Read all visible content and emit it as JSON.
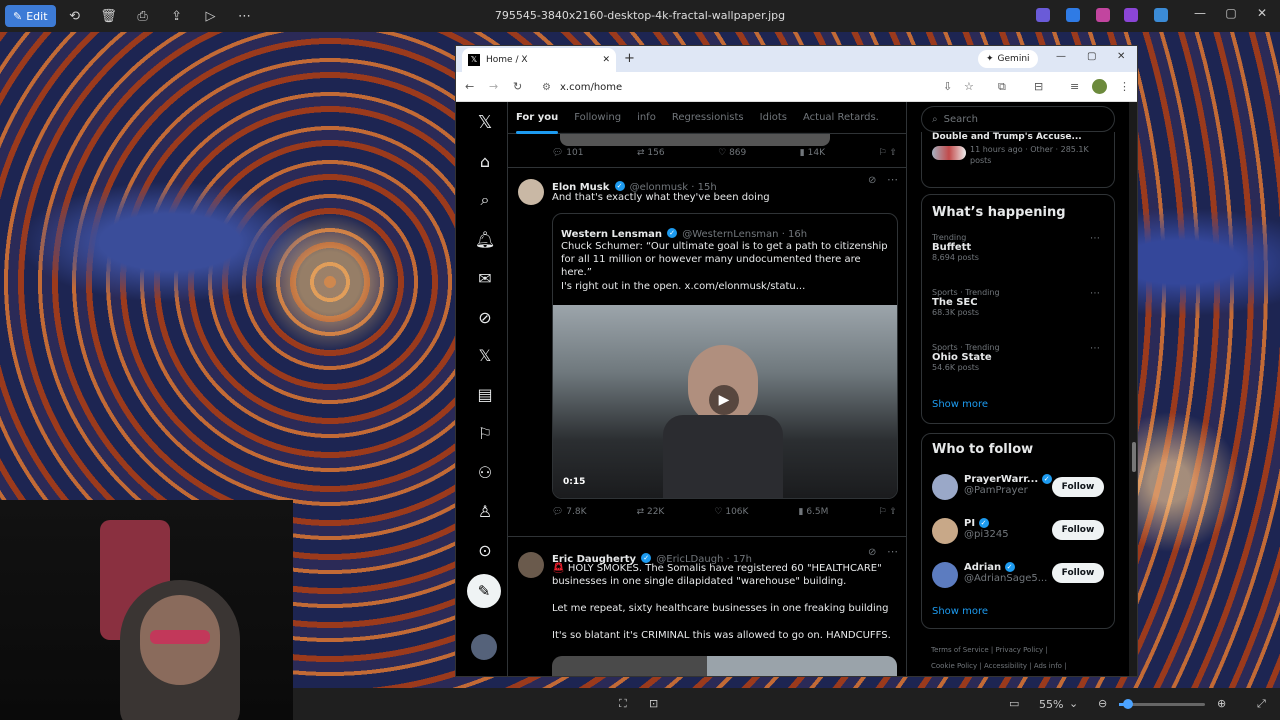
{
  "photos_app": {
    "edit_label": "Edit",
    "file_title": "795545-3840x2160-desktop-4k-fractal-wallpaper.jpg",
    "zoom": "55%"
  },
  "browser": {
    "tab_title": "Home / X",
    "url": "x.com/home",
    "gemini_label": "Gemini"
  },
  "x": {
    "tabs": [
      {
        "label": "For you"
      },
      {
        "label": "Following"
      },
      {
        "label": "info"
      },
      {
        "label": "Regressionists"
      },
      {
        "label": "Idiots"
      },
      {
        "label": "Actual Retards."
      }
    ],
    "prev_post_metrics": {
      "replies": "101",
      "reposts": "156",
      "likes": "869",
      "views": "14K"
    },
    "post1": {
      "name": "Elon Musk",
      "handle": "@elonmusk · 15h",
      "text": "And that's exactly what they've been doing",
      "quote": {
        "name": "Western Lensman",
        "handle": "@WesternLensman · 16h",
        "text1": "Chuck Schumer: “Our ultimate goal is to get a path to citizenship for all 11 million or however many undocumented there are here.”",
        "text2": "I's right out in the open.",
        "link": "x.com/elonmusk/statu...",
        "video_time": "0:15"
      },
      "metrics": {
        "replies": "7.8K",
        "reposts": "22K",
        "likes": "106K",
        "views": "6.5M"
      }
    },
    "post2": {
      "name": "Eric Daugherty",
      "handle": "@EricLDaugh · 17h",
      "text1": "HOLY SMOKES. The Somalis have registered 60 \"HEALTHCARE\" businesses in one single dilapidated \"warehouse\" building.",
      "text2": "Let me repeat, sixty healthcare businesses in one freaking building",
      "text3": "It's so blatant it's CRIMINAL this was allowed to go on. HANDCUFFS."
    },
    "search_placeholder": "Search",
    "top_partial": {
      "title": "Double and Trump's Accuse...",
      "meta": "11 hours ago · Other · 285.1K posts"
    },
    "whats_happening": {
      "title": "What’s happening",
      "items": [
        {
          "context": "Trending",
          "name": "Buffett",
          "posts": "8,694 posts"
        },
        {
          "context": "Sports · Trending",
          "name": "The SEC",
          "posts": "68.3K posts"
        },
        {
          "context": "Sports · Trending",
          "name": "Ohio State",
          "posts": "54.6K posts"
        }
      ],
      "show_more": "Show more"
    },
    "who_to_follow": {
      "title": "Who to follow",
      "items": [
        {
          "name": "PrayerWarr...",
          "handle": "@PamPrayer",
          "button": "Follow"
        },
        {
          "name": "PI",
          "handle": "@pi3245",
          "button": "Follow"
        },
        {
          "name": "Adrian",
          "handle": "@AdrianSage5...",
          "button": "Follow"
        }
      ],
      "show_more": "Show more"
    },
    "footer_links": [
      "Terms of Service",
      "Privacy Policy",
      "Cookie Policy",
      "Accessibility",
      "Ads info"
    ]
  }
}
